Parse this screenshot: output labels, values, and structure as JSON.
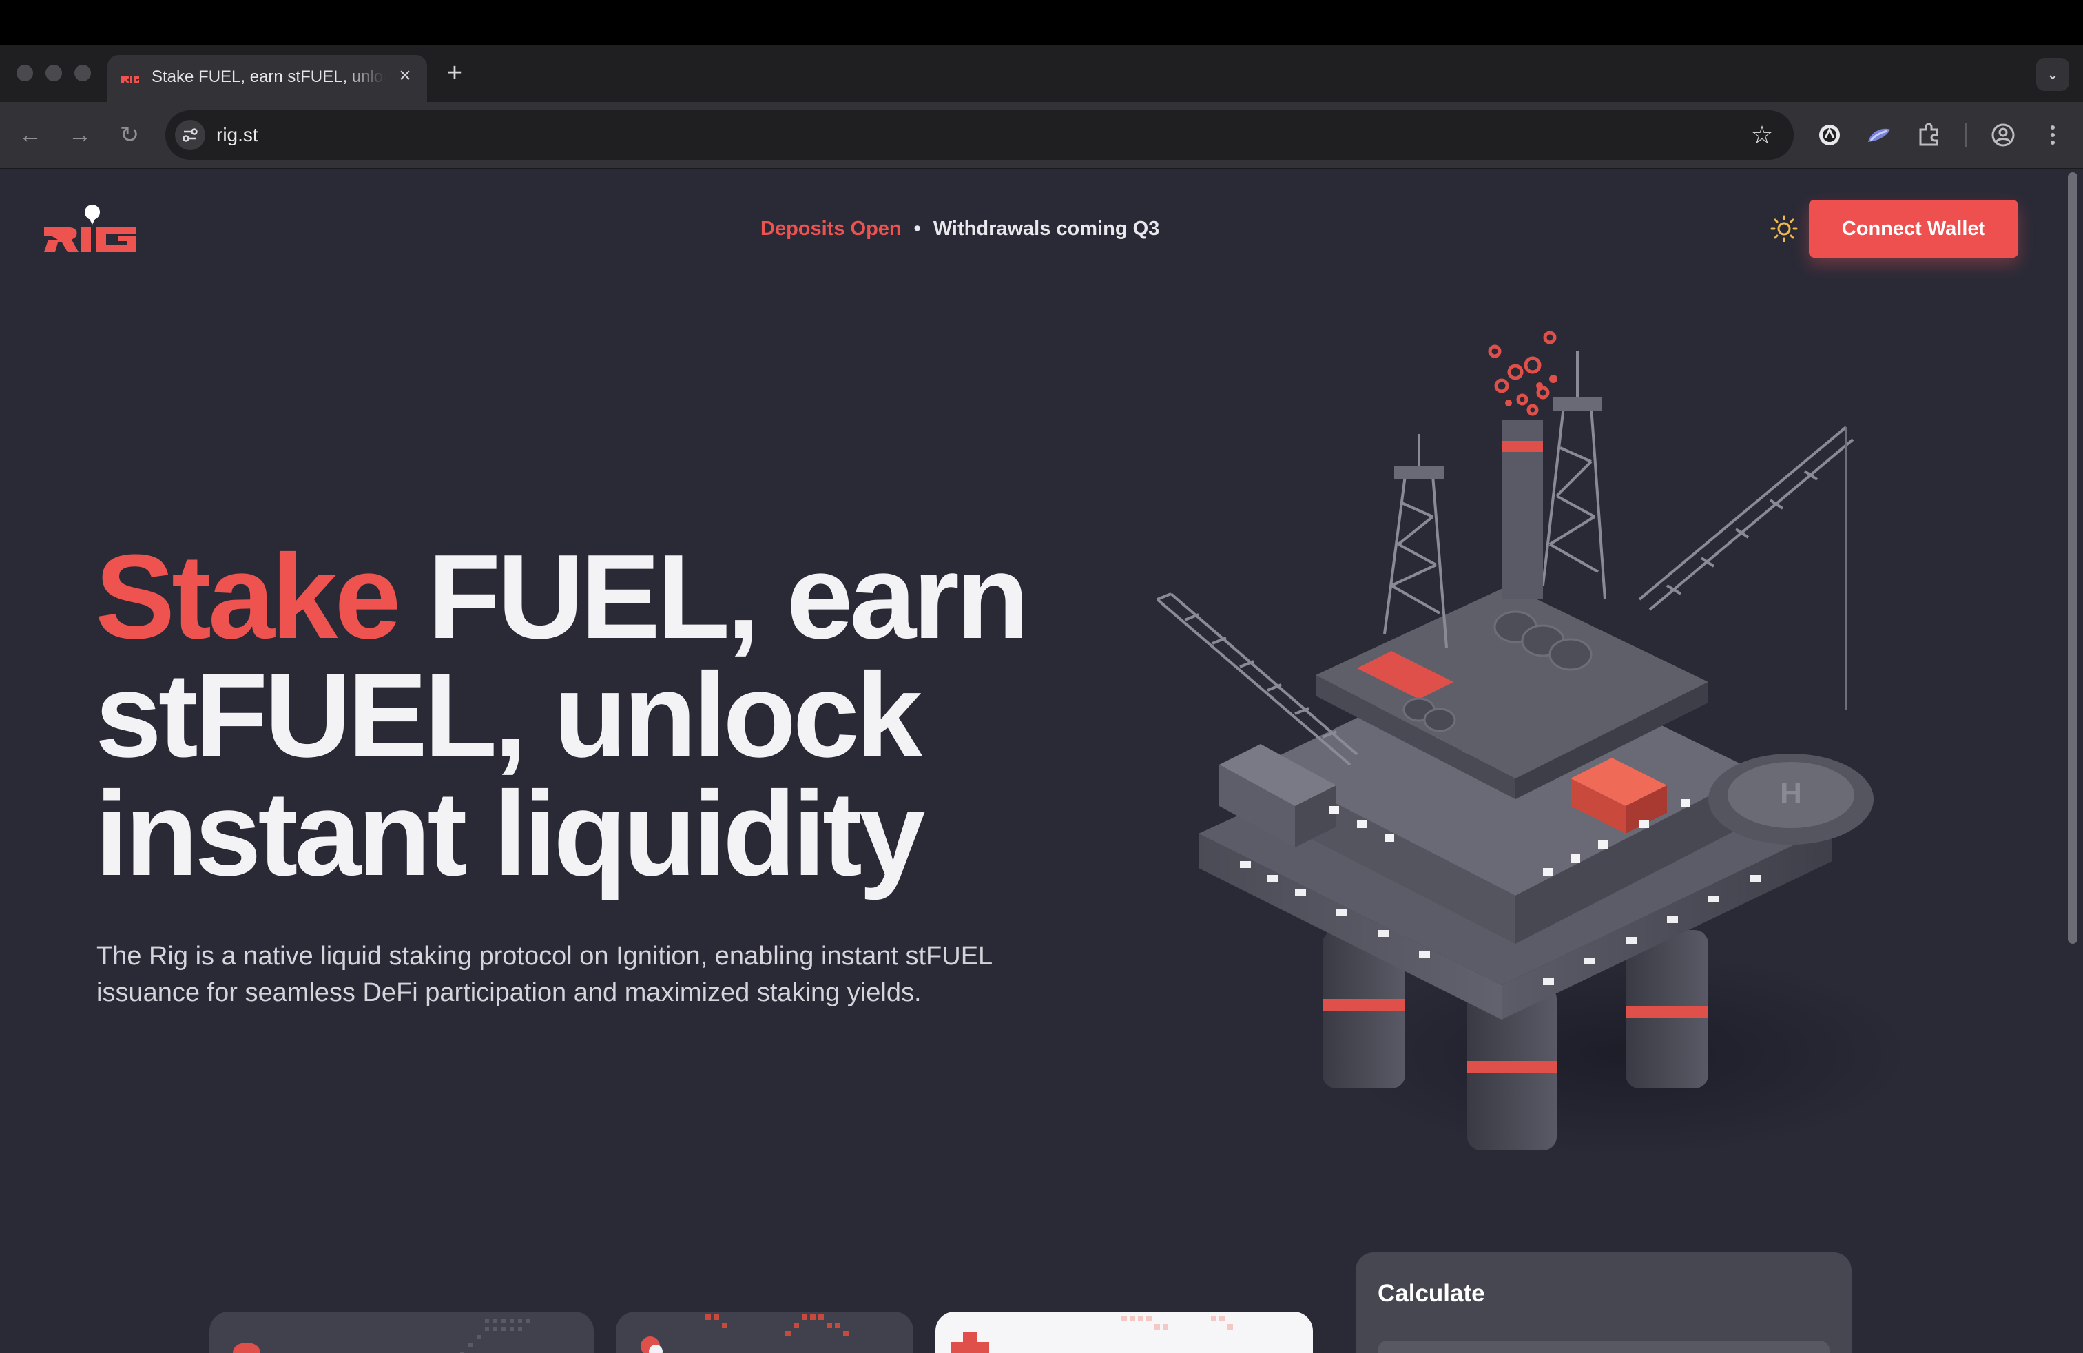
{
  "browser": {
    "tab_title": "Stake FUEL, earn stFUEL, unlock instant liquidity",
    "tab_close": "×",
    "new_tab": "+",
    "tab_menu": "⌄",
    "back": "←",
    "forward": "→",
    "reload": "↻",
    "url": "rig.st",
    "bookmark": "☆"
  },
  "header": {
    "logo_text": "RIG",
    "status_open": "Deposits Open",
    "status_separator": "•",
    "status_withdrawals": "Withdrawals coming Q3",
    "connect_label": "Connect Wallet"
  },
  "hero": {
    "accent_word": "Stake",
    "line1_rest": " FUEL, earn",
    "line2": "stFUEL, unlock",
    "line3": "instant liquidity",
    "subtitle": "The Rig is a native liquid staking protocol on Ignition, enabling instant stFUEL issuance for seamless DeFi participation and maximized staking yields."
  },
  "calculator": {
    "title": "Calculate"
  },
  "colors": {
    "accent": "#ef5350",
    "page_bg": "#2a2a37",
    "button_bg": "#ee5050"
  }
}
